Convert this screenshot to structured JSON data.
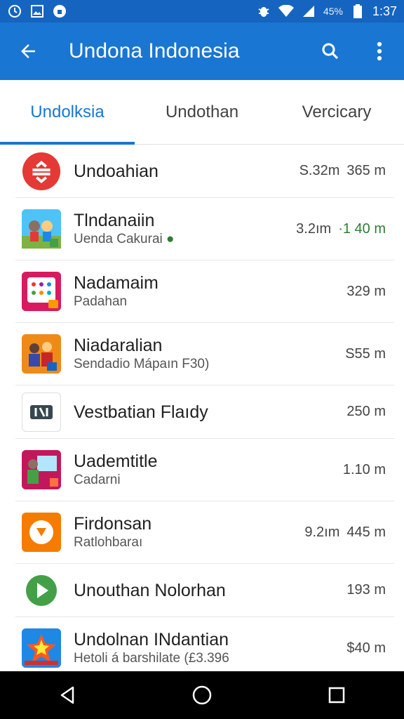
{
  "status_bar": {
    "battery_percent": "45%",
    "time": "1:37",
    "icons": [
      "clock-icon",
      "gallery-icon",
      "shield-icon",
      "bug-icon",
      "wifi-icon",
      "signal-icon",
      "battery-icon"
    ]
  },
  "app_bar": {
    "title": "Undona Indonesia",
    "back_icon": "arrow-back-icon",
    "search_icon": "search-icon",
    "menu_icon": "more-vert-icon"
  },
  "tabs": [
    {
      "label": "Undolksia",
      "active": true
    },
    {
      "label": "Undothan",
      "active": false
    },
    {
      "label": "Vercicary",
      "active": false
    }
  ],
  "colors": {
    "status_bar": "#1565c0",
    "app_bar": "#1976d2",
    "accent": "#1976d2"
  },
  "items": [
    {
      "name": "Undoahian",
      "sub": "",
      "meta1": "S.32m",
      "meta2": "365 m",
      "icon": "red-circle-icon"
    },
    {
      "name": "Tlndanaiin",
      "sub": "Uenda Cakurai",
      "meta1": "3.2ım",
      "meta2": "·1 40 m",
      "icon": "kids-app-icon"
    },
    {
      "name": "Nadamaim",
      "sub": "Padahan",
      "meta1": "",
      "meta2": "329 m",
      "icon": "grid-app-icon"
    },
    {
      "name": "Niadaralian",
      "sub": "Sendadio Mápaın F30)",
      "meta1": "",
      "meta2": "S55 m",
      "icon": "people-app-icon"
    },
    {
      "name": "Vestbatian Flaıdy",
      "sub": "",
      "meta1": "",
      "meta2": "250 m",
      "icon": "dark-logo-icon"
    },
    {
      "name": "Uademtitle",
      "sub": "Cadarni",
      "meta1": "",
      "meta2": "1.10 m",
      "icon": "teacher-app-icon"
    },
    {
      "name": "Firdonsan",
      "sub": "Ratlohbaraı",
      "meta1": "9.2ım",
      "meta2": "445 m",
      "icon": "orange-play-icon"
    },
    {
      "name": "Unouthan Nolorhan",
      "sub": "",
      "meta1": "",
      "meta2": "193 m",
      "icon": "green-play-icon"
    },
    {
      "name": "Undolnan INdantian",
      "sub": "Hetoli á barshilate (£3.396",
      "meta1": "",
      "meta2": "$40 m",
      "icon": "star-badge-icon"
    }
  ],
  "nav_bar": {
    "back": "nav-back-icon",
    "home": "nav-home-icon",
    "recents": "nav-recents-icon"
  }
}
